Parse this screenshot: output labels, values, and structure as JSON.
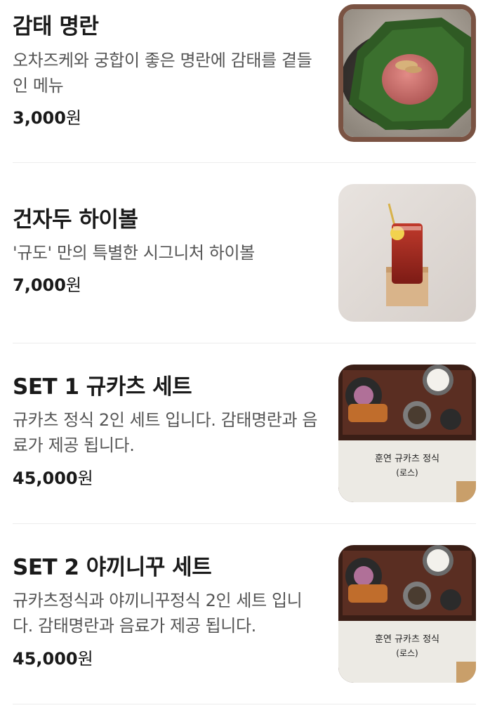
{
  "menu": {
    "items": [
      {
        "name": "감태 명란",
        "description": "오차즈케와 궁합이 좋은 명란에 감태를 곁들인 메뉴",
        "price_number": "3,000",
        "price_unit": "원",
        "image_icon": "myeongran-dish-photo"
      },
      {
        "name": "건자두 하이볼",
        "description": "'규도' 만의 특별한 시그니처 하이볼",
        "price_number": "7,000",
        "price_unit": "원",
        "image_icon": "highball-drink-photo"
      },
      {
        "name": "SET 1 규카츠 세트",
        "description": "규카츠 정식 2인 세트 입니다. 감태명란과 음료가 제공 됩니다.",
        "price_number": "45,000",
        "price_unit": "원",
        "image_icon": "gyukatsu-set-photo",
        "image_caption_line1": "훈연 규카츠 정식",
        "image_caption_line2": "(로스)"
      },
      {
        "name": "SET 2 야끼니꾸 세트",
        "description": "규카츠정식과 야끼니꾸정식 2인 세트 입니다. 감태명란과 음료가 제공 됩니다.",
        "price_number": "45,000",
        "price_unit": "원",
        "image_icon": "yakiniku-set-photo",
        "image_caption_line1": "훈연 규카츠 정식",
        "image_caption_line2": "(로스)"
      }
    ]
  },
  "colors": {
    "border_accent": "#7a5343",
    "text_primary": "#1a1a1a",
    "text_secondary": "#555555",
    "divider": "#ececec"
  }
}
